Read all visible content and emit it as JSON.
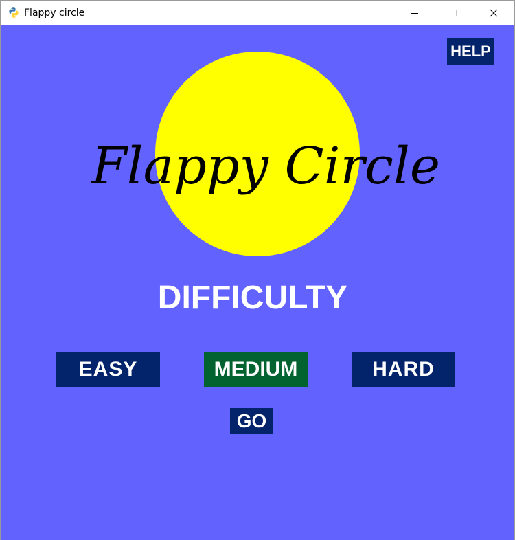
{
  "window": {
    "title": "Flappy circle",
    "app_icon": "python-snake-icon",
    "minimize_icon": "minimize-icon",
    "maximize_icon": "maximize-icon",
    "close_icon": "close-icon"
  },
  "game": {
    "logo_text": "Flappy Circle",
    "difficulty_label": "DIFFICULTY",
    "help_label": "HELP",
    "go_label": "GO",
    "difficulty_options": [
      "EASY",
      "MEDIUM",
      "HARD"
    ],
    "selected_difficulty": "MEDIUM",
    "colors": {
      "background": "#6262ff",
      "circle": "#ffff00",
      "button": "#03236b",
      "button_selected": "#036330",
      "text": "#ffffff",
      "logo_text": "#000000"
    }
  }
}
